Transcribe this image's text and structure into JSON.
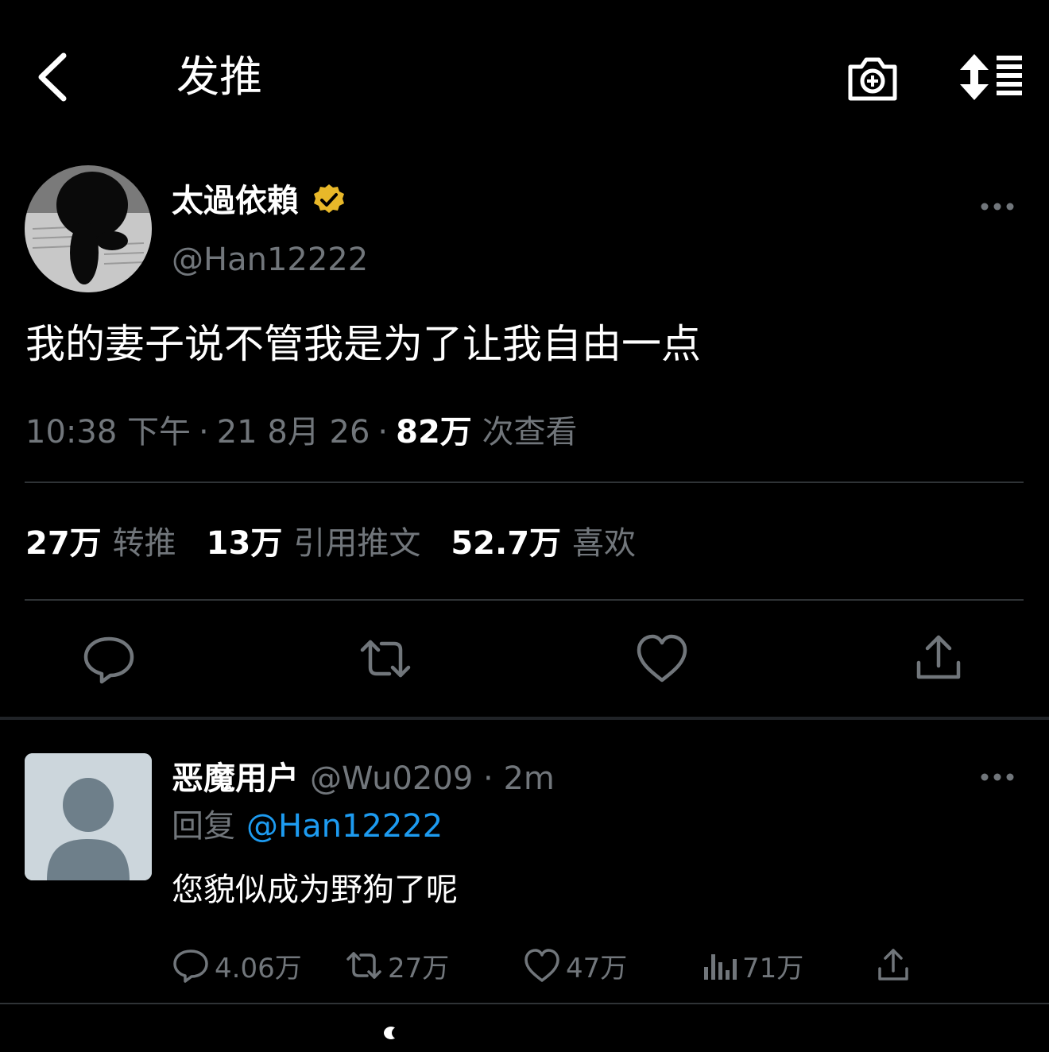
{
  "header": {
    "title": "发推",
    "icons": [
      "back-icon",
      "camera-add-icon",
      "sort-icon"
    ]
  },
  "tweet": {
    "author_name": "太過依賴",
    "author_handle": "@Han12222",
    "verified": true,
    "text": "我的妻子说不管我是为了让我自由一点",
    "time": "10:38 下午",
    "date": "21 8月 26",
    "views_count": "82万",
    "views_label": "次查看",
    "stats": {
      "retweets_count": "27万",
      "retweets_label": "转推",
      "quotes_count": "13万",
      "quotes_label": "引用推文",
      "likes_count": "52.7万",
      "likes_label": "喜欢"
    }
  },
  "reply": {
    "author_name": "恶魔用户",
    "author_handle": "@Wu0209",
    "time": "2m",
    "reply_to_label": "回复",
    "reply_to_user": "@Han12222",
    "text": "您貌似成为野狗了呢",
    "actions": {
      "replies": "4.06万",
      "retweets": "27万",
      "likes": "47万",
      "views": "71万"
    }
  },
  "colors": {
    "background": "#000000",
    "text": "#e7e9ea",
    "muted": "#71767b",
    "accent": "#1d9bf0",
    "verified": "#e8b829"
  }
}
